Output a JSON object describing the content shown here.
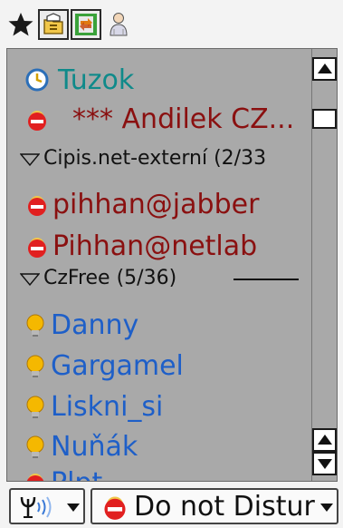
{
  "toolbar": {
    "buttons": [
      {
        "icon": "star-icon",
        "pressed": false
      },
      {
        "icon": "folder-settings-icon",
        "pressed": true
      },
      {
        "icon": "transfer-arrows-icon",
        "pressed": true
      },
      {
        "icon": "person-icon",
        "pressed": false
      }
    ]
  },
  "roster": {
    "contacts": [
      {
        "name": "Tuzok",
        "status": "away",
        "color": "#0f8a8a",
        "icon": "away-clock-icon"
      },
      {
        "name": "*** Andilek CZ...",
        "status": "dnd",
        "color": "#8a1010",
        "icon": "dnd-status-icon"
      },
      {
        "group": "Cipis.net-externí (2/33",
        "expanded": true
      },
      {
        "name": "pihhan@jabber",
        "status": "dnd",
        "color": "#8a1010",
        "icon": "dnd-status-icon"
      },
      {
        "name": "Pihhan@netlab",
        "status": "dnd",
        "color": "#8a1010",
        "icon": "dnd-status-icon"
      },
      {
        "group": "CzFree (5/36)",
        "expanded": true
      },
      {
        "name": "Danny",
        "status": "online",
        "color": "#1e5fc8",
        "icon": "lightbulb-icon"
      },
      {
        "name": "Gargamel",
        "status": "online",
        "color": "#1e5fc8",
        "icon": "lightbulb-icon"
      },
      {
        "name": "Liskni_si",
        "status": "online",
        "color": "#1e5fc8",
        "icon": "lightbulb-icon"
      },
      {
        "name": "Nuňák",
        "status": "online",
        "color": "#1e5fc8",
        "icon": "lightbulb-icon"
      },
      {
        "name": "Plpt",
        "status": "dnd",
        "color": "#1e5fc8",
        "icon": "dnd-status-icon"
      }
    ]
  },
  "statusbar": {
    "network_icon": "antenna-icon",
    "status_label": "Do not Distur",
    "status_icon": "dnd-status-icon"
  }
}
